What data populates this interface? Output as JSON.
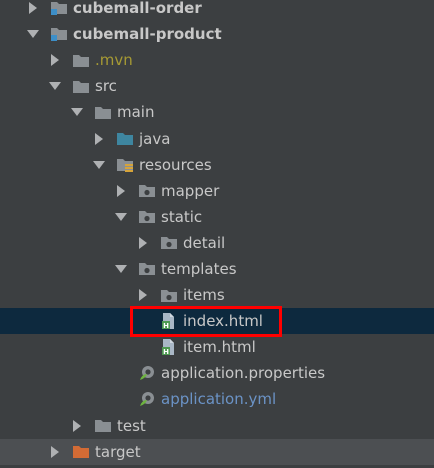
{
  "tree": {
    "nodes": [
      {
        "label": "cubemall-order",
        "indent": 26,
        "expanded": false,
        "icon": "module-folder-icon",
        "style": "bold"
      },
      {
        "label": "cubemall-product",
        "indent": 26,
        "expanded": true,
        "icon": "module-folder-icon",
        "style": "bold"
      },
      {
        "label": ".mvn",
        "indent": 48,
        "expanded": false,
        "icon": "folder-icon",
        "style": "mvn"
      },
      {
        "label": "src",
        "indent": 48,
        "expanded": true,
        "icon": "folder-icon",
        "style": "default"
      },
      {
        "label": "main",
        "indent": 70,
        "expanded": true,
        "icon": "folder-icon",
        "style": "default"
      },
      {
        "label": "java",
        "indent": 92,
        "expanded": false,
        "icon": "source-folder-icon",
        "style": "default"
      },
      {
        "label": "resources",
        "indent": 92,
        "expanded": true,
        "icon": "resources-folder-icon",
        "style": "default"
      },
      {
        "label": "mapper",
        "indent": 114,
        "expanded": false,
        "icon": "package-folder-icon",
        "style": "default"
      },
      {
        "label": "static",
        "indent": 114,
        "expanded": true,
        "icon": "package-folder-icon",
        "style": "default"
      },
      {
        "label": "detail",
        "indent": 136,
        "expanded": false,
        "icon": "package-folder-icon",
        "style": "default"
      },
      {
        "label": "templates",
        "indent": 114,
        "expanded": true,
        "icon": "package-folder-icon",
        "style": "default"
      },
      {
        "label": "items",
        "indent": 136,
        "expanded": false,
        "icon": "package-folder-icon",
        "style": "default"
      },
      {
        "label": "index.html",
        "indent": 136,
        "expanded": null,
        "icon": "html-file-icon",
        "style": "default",
        "selected": true
      },
      {
        "label": "item.html",
        "indent": 136,
        "expanded": null,
        "icon": "html-file-icon",
        "style": "default"
      },
      {
        "label": "application.properties",
        "indent": 114,
        "expanded": null,
        "icon": "spring-config-icon",
        "style": "default"
      },
      {
        "label": "application.yml",
        "indent": 114,
        "expanded": null,
        "icon": "spring-config-icon",
        "style": "yml"
      },
      {
        "label": "test",
        "indent": 70,
        "expanded": false,
        "icon": "folder-icon",
        "style": "default"
      },
      {
        "label": "target",
        "indent": 48,
        "expanded": false,
        "icon": "excluded-folder-icon",
        "style": "default",
        "last": true
      }
    ]
  },
  "colors": {
    "background": "#3c3f41",
    "selected_row": "#0d293e",
    "highlight_border": "#ff0000",
    "text": "#c8c8c8",
    "mvn_text": "#a69a34",
    "yml_text": "#6b93c6",
    "folder": "#8a8f93",
    "source_folder": "#3e86a0",
    "excluded_folder": "#d26b35"
  }
}
